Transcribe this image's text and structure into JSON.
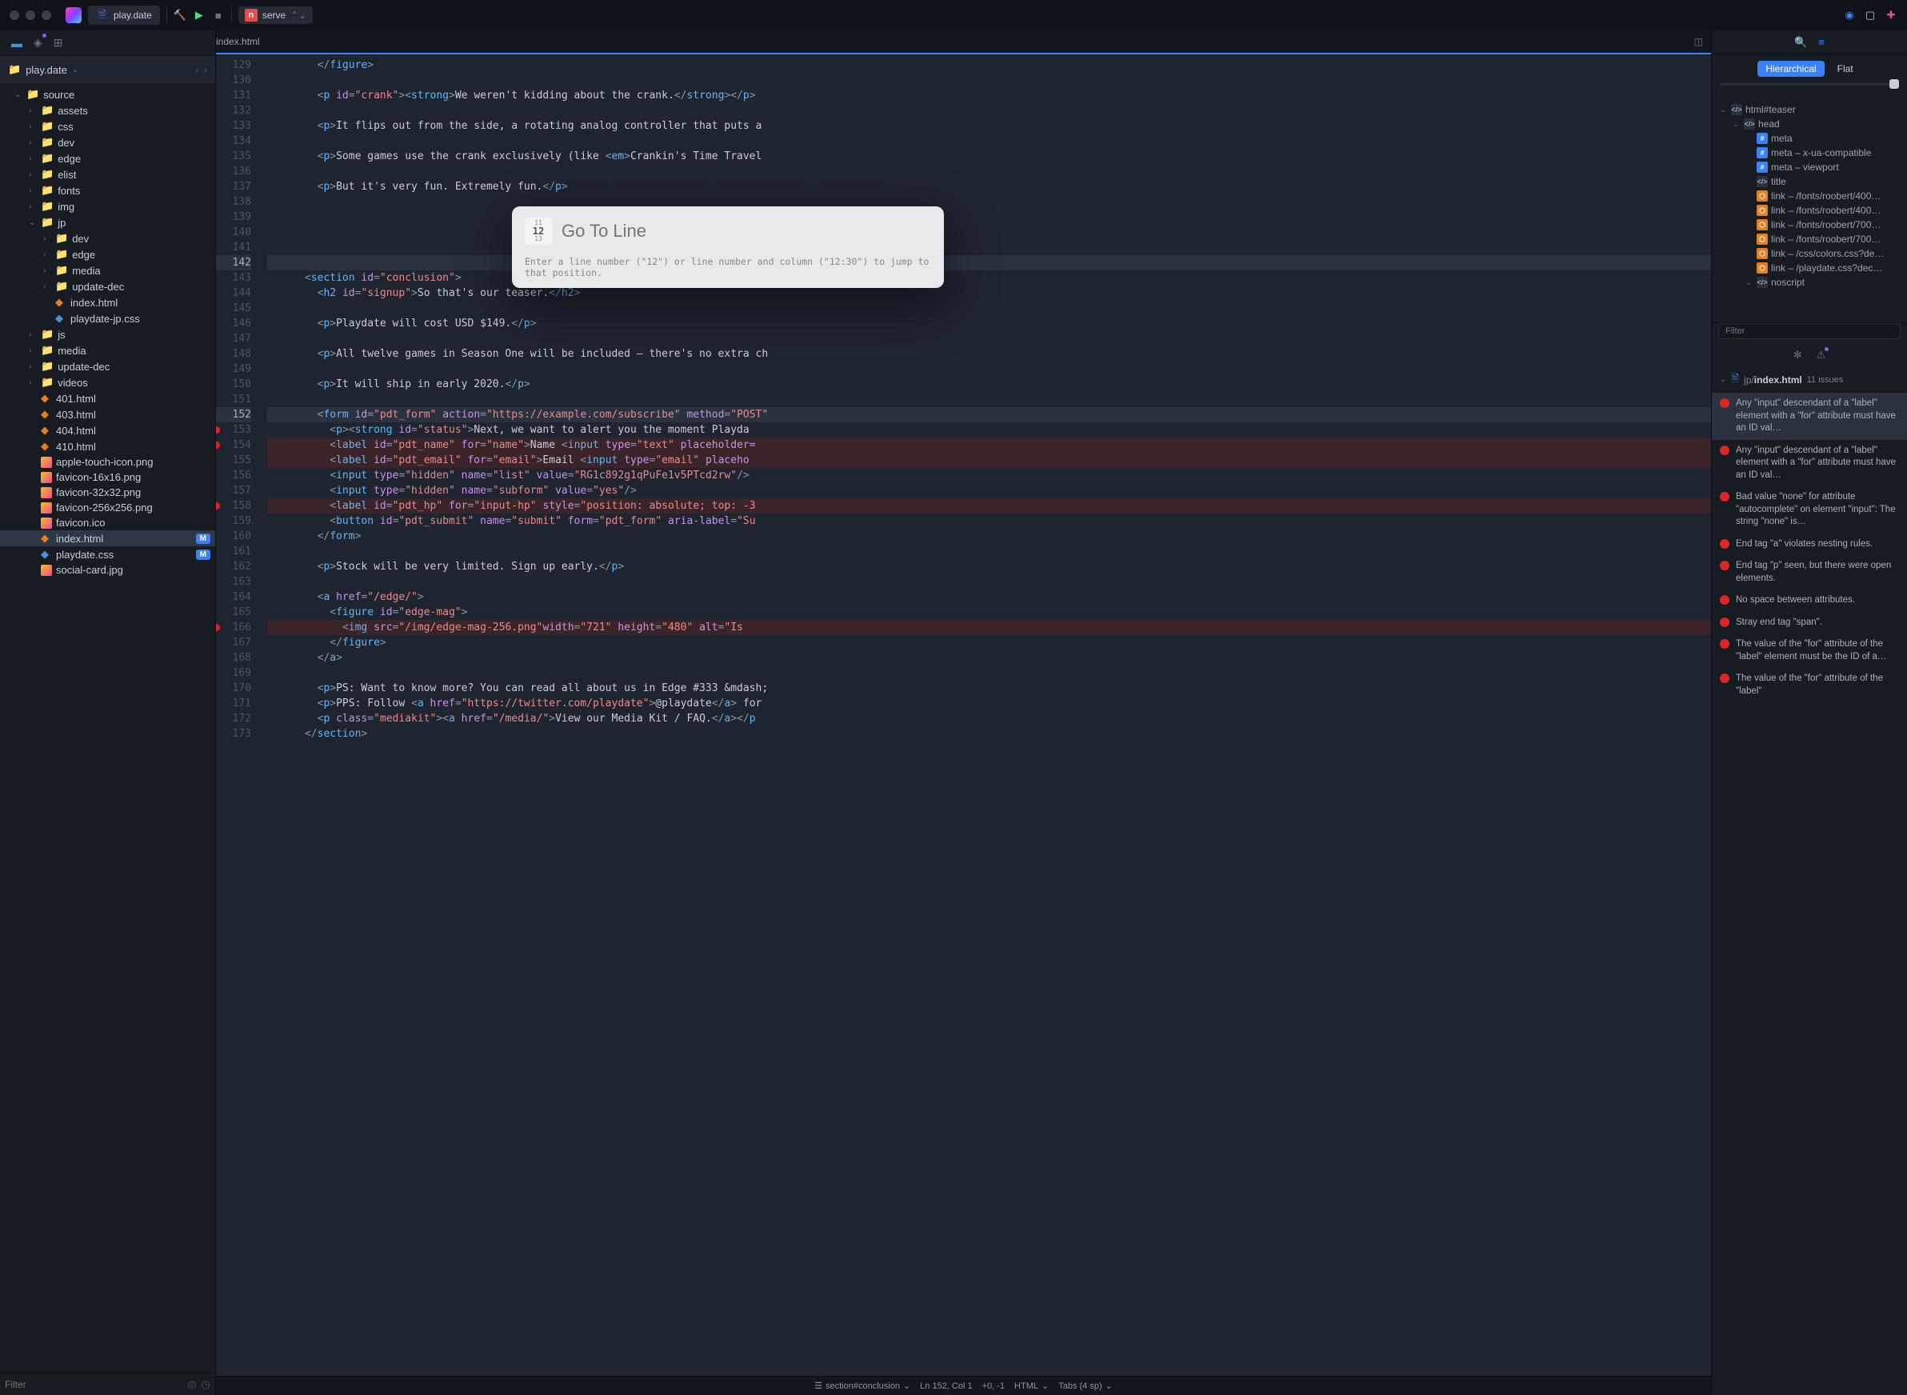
{
  "titlebar": {
    "tab_name": "play.date",
    "serve_label": "serve"
  },
  "sidebar": {
    "path_label": "play.date",
    "items": [
      {
        "label": "source",
        "type": "folder",
        "depth": 1,
        "exp": true
      },
      {
        "label": "assets",
        "type": "folder",
        "depth": 2
      },
      {
        "label": "css",
        "type": "folder",
        "depth": 2
      },
      {
        "label": "dev",
        "type": "folder",
        "depth": 2
      },
      {
        "label": "edge",
        "type": "folder",
        "depth": 2
      },
      {
        "label": "elist",
        "type": "folder",
        "depth": 2
      },
      {
        "label": "fonts",
        "type": "folder",
        "depth": 2
      },
      {
        "label": "img",
        "type": "folder",
        "depth": 2
      },
      {
        "label": "jp",
        "type": "folder",
        "depth": 2,
        "exp": true
      },
      {
        "label": "dev",
        "type": "folder",
        "depth": 3
      },
      {
        "label": "edge",
        "type": "folder",
        "depth": 3
      },
      {
        "label": "media",
        "type": "folder",
        "depth": 3
      },
      {
        "label": "update-dec",
        "type": "folder",
        "depth": 3
      },
      {
        "label": "index.html",
        "type": "html",
        "depth": 3
      },
      {
        "label": "playdate-jp.css",
        "type": "css",
        "depth": 3
      },
      {
        "label": "js",
        "type": "folder",
        "depth": 2
      },
      {
        "label": "media",
        "type": "folder",
        "depth": 2
      },
      {
        "label": "update-dec",
        "type": "folder",
        "depth": 2
      },
      {
        "label": "videos",
        "type": "folder",
        "depth": 2
      },
      {
        "label": "401.html",
        "type": "html",
        "depth": 2
      },
      {
        "label": "403.html",
        "type": "html",
        "depth": 2
      },
      {
        "label": "404.html",
        "type": "html",
        "depth": 2
      },
      {
        "label": "410.html",
        "type": "html",
        "depth": 2
      },
      {
        "label": "apple-touch-icon.png",
        "type": "img",
        "depth": 2
      },
      {
        "label": "favicon-16x16.png",
        "type": "img",
        "depth": 2
      },
      {
        "label": "favicon-32x32.png",
        "type": "img",
        "depth": 2
      },
      {
        "label": "favicon-256x256.png",
        "type": "img",
        "depth": 2
      },
      {
        "label": "favicon.ico",
        "type": "img",
        "depth": 2
      },
      {
        "label": "index.html",
        "type": "html",
        "depth": 2,
        "sel": true,
        "mod": "M"
      },
      {
        "label": "playdate.css",
        "type": "css",
        "depth": 2,
        "mod": "M"
      },
      {
        "label": "social-card.jpg",
        "type": "img",
        "depth": 2
      }
    ],
    "filter_placeholder": "Filter"
  },
  "editor": {
    "filename": "index.html",
    "first_line": 129,
    "goto": {
      "placeholder": "Go To Line",
      "hint": "Enter a line number (\"12\") or line number and column (\"12:30\") to jump to that position."
    },
    "status": {
      "symbol": "section#conclusion",
      "pos": "Ln 152, Col 1",
      "diag": "+0, -1",
      "lang": "HTML",
      "tabs": "Tabs (4 sp)"
    }
  },
  "rightpanel": {
    "tabs": {
      "hierarchical": "Hierarchical",
      "flat": "Flat"
    },
    "dom": [
      {
        "l": "html#teaser",
        "d": 1,
        "c": true,
        "ic": "tag"
      },
      {
        "l": "head",
        "d": 2,
        "c": true,
        "ic": "tag"
      },
      {
        "l": "meta",
        "d": 3,
        "ic": "hash"
      },
      {
        "l": "meta – x-ua-compatible",
        "d": 3,
        "ic": "hash"
      },
      {
        "l": "meta – viewport",
        "d": 3,
        "ic": "hash"
      },
      {
        "l": "title",
        "d": 3,
        "ic": "tag"
      },
      {
        "l": "link – /fonts/roobert/400…",
        "d": 3,
        "ic": "link"
      },
      {
        "l": "link – /fonts/roobert/400…",
        "d": 3,
        "ic": "link"
      },
      {
        "l": "link – /fonts/roobert/700…",
        "d": 3,
        "ic": "link"
      },
      {
        "l": "link – /fonts/roobert/700…",
        "d": 3,
        "ic": "link"
      },
      {
        "l": "link – /css/colors.css?de…",
        "d": 3,
        "ic": "link"
      },
      {
        "l": "link – /playdate.css?dec…",
        "d": 3,
        "ic": "link"
      },
      {
        "l": "noscript",
        "d": 3,
        "c": true,
        "ic": "tag"
      }
    ],
    "filter_placeholder": "Filter",
    "issues_path_prefix": "jp/",
    "issues_file": "index.html",
    "issues_count": "11 issues",
    "issues": [
      "Any \"input\" descendant of a \"label\" element with a \"for\" attribute must have an ID val…",
      "Any \"input\" descendant of a \"label\" element with a \"for\" attribute must have an ID val…",
      "Bad value \"none\" for attribute \"autocomplete\" on element \"input\": The string \"none\" is…",
      "End tag \"a\" violates nesting rules.",
      "End tag \"p\" seen, but there were open elements.",
      "No space between attributes.",
      "Stray end tag \"span\".",
      "The value of the \"for\" attribute of the \"label\" element must be the ID of a…",
      "The value of the \"for\" attribute of the \"label\""
    ]
  }
}
